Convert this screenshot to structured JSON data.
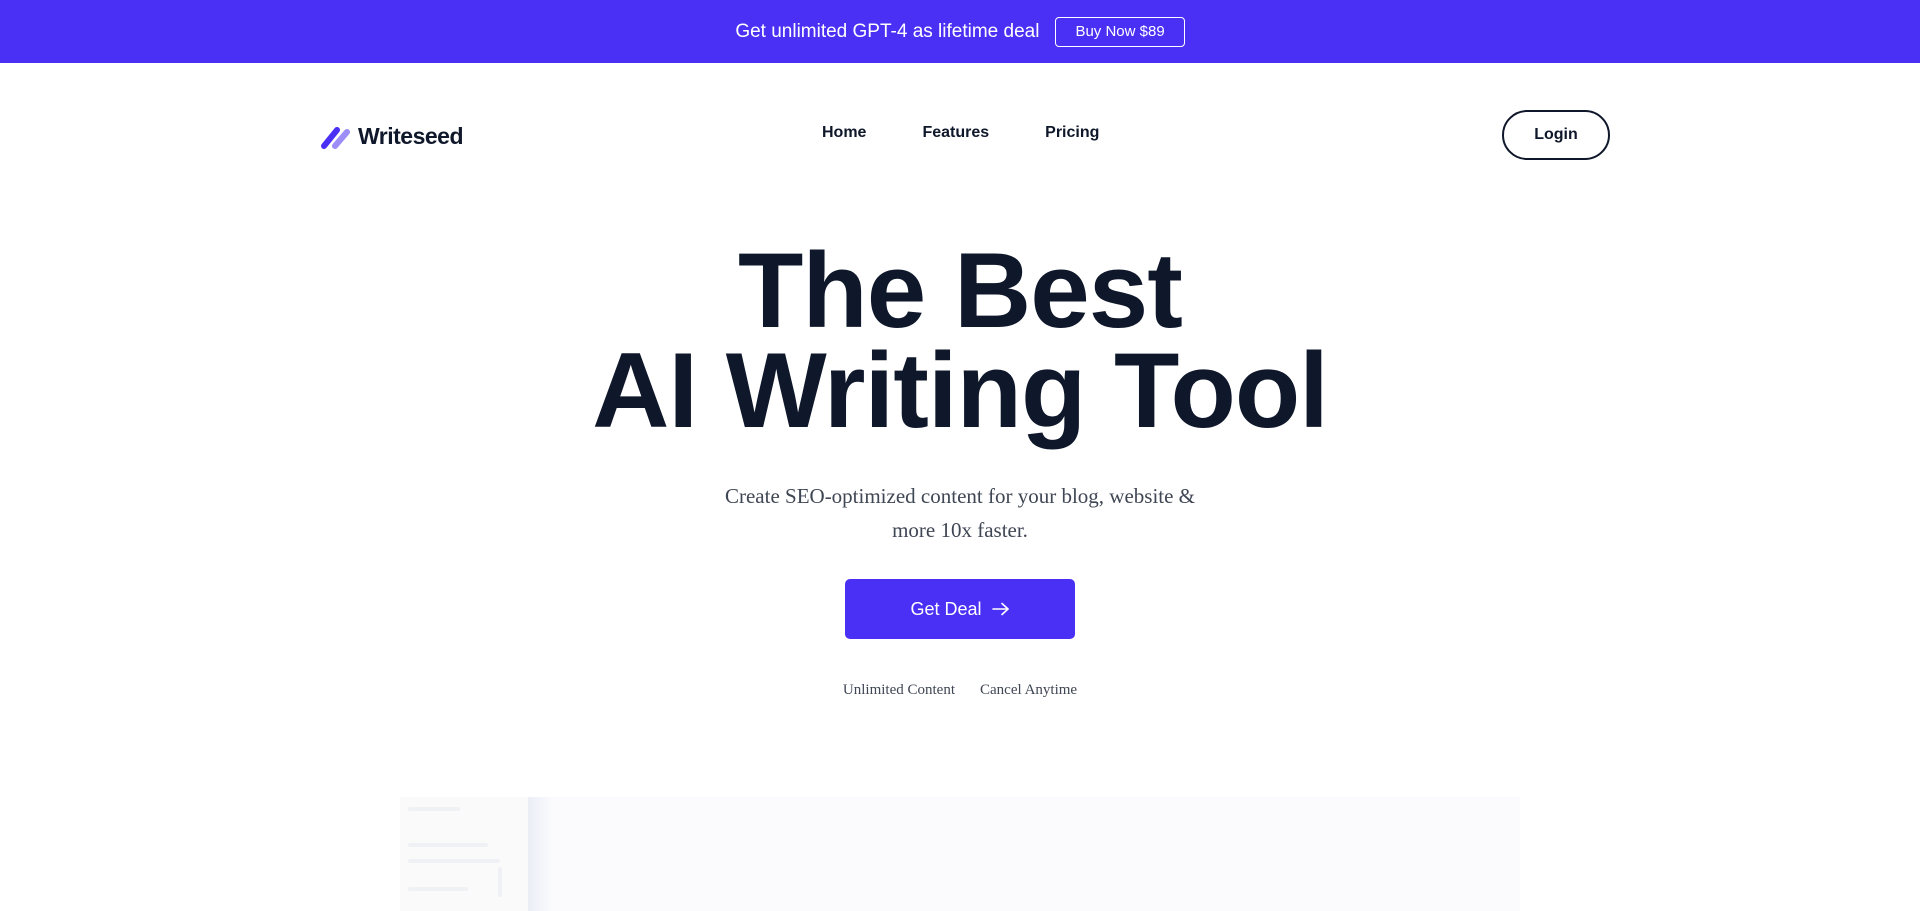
{
  "promo": {
    "text": "Get unlimited GPT-4 as lifetime deal",
    "button_label": "Buy Now $89"
  },
  "brand": {
    "name": "Writeseed",
    "accent_color": "#4a2ff4",
    "logo_icon": "double-slash-logo-icon"
  },
  "nav": {
    "items": [
      {
        "label": "Home"
      },
      {
        "label": "Features"
      },
      {
        "label": "Pricing"
      }
    ],
    "login_label": "Login"
  },
  "hero": {
    "title_line1": "The Best",
    "title_line2": "AI Writing Tool",
    "subtitle": "Create SEO-optimized content for your blog, website & more 10x faster.",
    "cta_label": "Get Deal",
    "cta_icon": "arrow-right-icon",
    "features": [
      {
        "label": "Unlimited Content"
      },
      {
        "label": "Cancel Anytime"
      }
    ]
  }
}
